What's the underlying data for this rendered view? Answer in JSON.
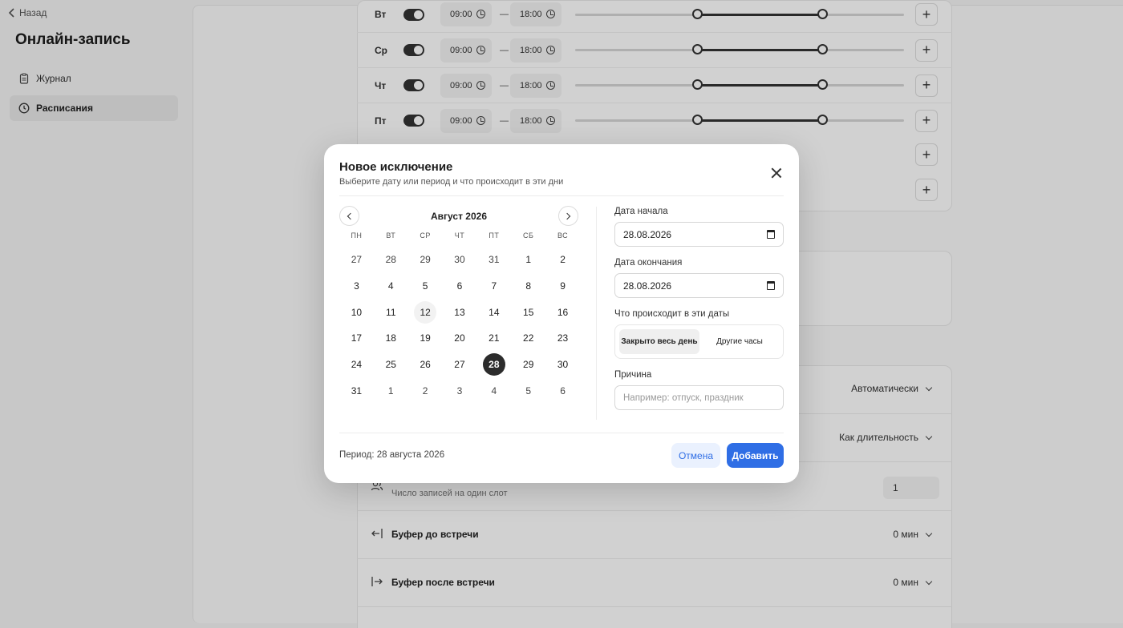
{
  "sidebar": {
    "back_label": "Назад",
    "app_title": "Онлайн-запись",
    "items": [
      {
        "label": "Журнал",
        "icon": "clipboard-icon",
        "active": false
      },
      {
        "label": "Расписания",
        "icon": "clock-icon",
        "active": true
      }
    ]
  },
  "schedule": {
    "days": [
      {
        "label": "Вт",
        "enabled": true,
        "start": "09:00",
        "end": "18:00",
        "range_fraction": [
          0.37,
          0.75
        ]
      },
      {
        "label": "Ср",
        "enabled": true,
        "start": "09:00",
        "end": "18:00",
        "range_fraction": [
          0.37,
          0.75
        ]
      },
      {
        "label": "Чт",
        "enabled": true,
        "start": "09:00",
        "end": "18:00",
        "range_fraction": [
          0.37,
          0.75
        ]
      },
      {
        "label": "Пт",
        "enabled": true,
        "start": "09:00",
        "end": "18:00",
        "range_fraction": [
          0.37,
          0.75
        ]
      }
    ],
    "separator": "—",
    "add_symbol": "+"
  },
  "settings": {
    "auto_value": "Автоматически",
    "duration_value": "Как длительность",
    "slots_sub": "Число записей на один слот",
    "slots_value": "1",
    "buffer_before_title": "Буфер до встречи",
    "buffer_before_value": "0 мин",
    "buffer_after_title": "Буфер после встречи",
    "buffer_after_value": "0 мин"
  },
  "modal": {
    "title": "Новое исключение",
    "subtitle": "Выберите дату или период и что происходит в эти дни",
    "calendar": {
      "month_label": "Август 2026",
      "weekdays": [
        "ПН",
        "ВТ",
        "СР",
        "ЧТ",
        "ПТ",
        "СБ",
        "ВС"
      ],
      "weeks": [
        [
          "27",
          "28",
          "29",
          "30",
          "31",
          "1",
          "2"
        ],
        [
          "3",
          "4",
          "5",
          "6",
          "7",
          "8",
          "9"
        ],
        [
          "10",
          "11",
          "12",
          "13",
          "14",
          "15",
          "16"
        ],
        [
          "17",
          "18",
          "19",
          "20",
          "21",
          "22",
          "23"
        ],
        [
          "24",
          "25",
          "26",
          "27",
          "28",
          "29",
          "30"
        ],
        [
          "31",
          "1",
          "2",
          "3",
          "4",
          "5",
          "6"
        ]
      ],
      "today": "12",
      "selected": "28"
    },
    "start_label": "Дата начала",
    "start_value": "28.08.2026",
    "end_label": "Дата окончания",
    "end_value": "28.08.2026",
    "what_label": "Что происходит в эти даты",
    "options": [
      "Закрыто весь день",
      "Другие часы"
    ],
    "active_option": 0,
    "reason_label": "Причина",
    "reason_placeholder": "Например: отпуск, праздник",
    "period_text": "Период: 28 августа 2026",
    "cancel_label": "Отмена",
    "add_label": "Добавить"
  },
  "colors": {
    "primary": "#2f6ee5",
    "primary_soft": "#eaf1fe",
    "selected_day": "#2c2c2c"
  }
}
